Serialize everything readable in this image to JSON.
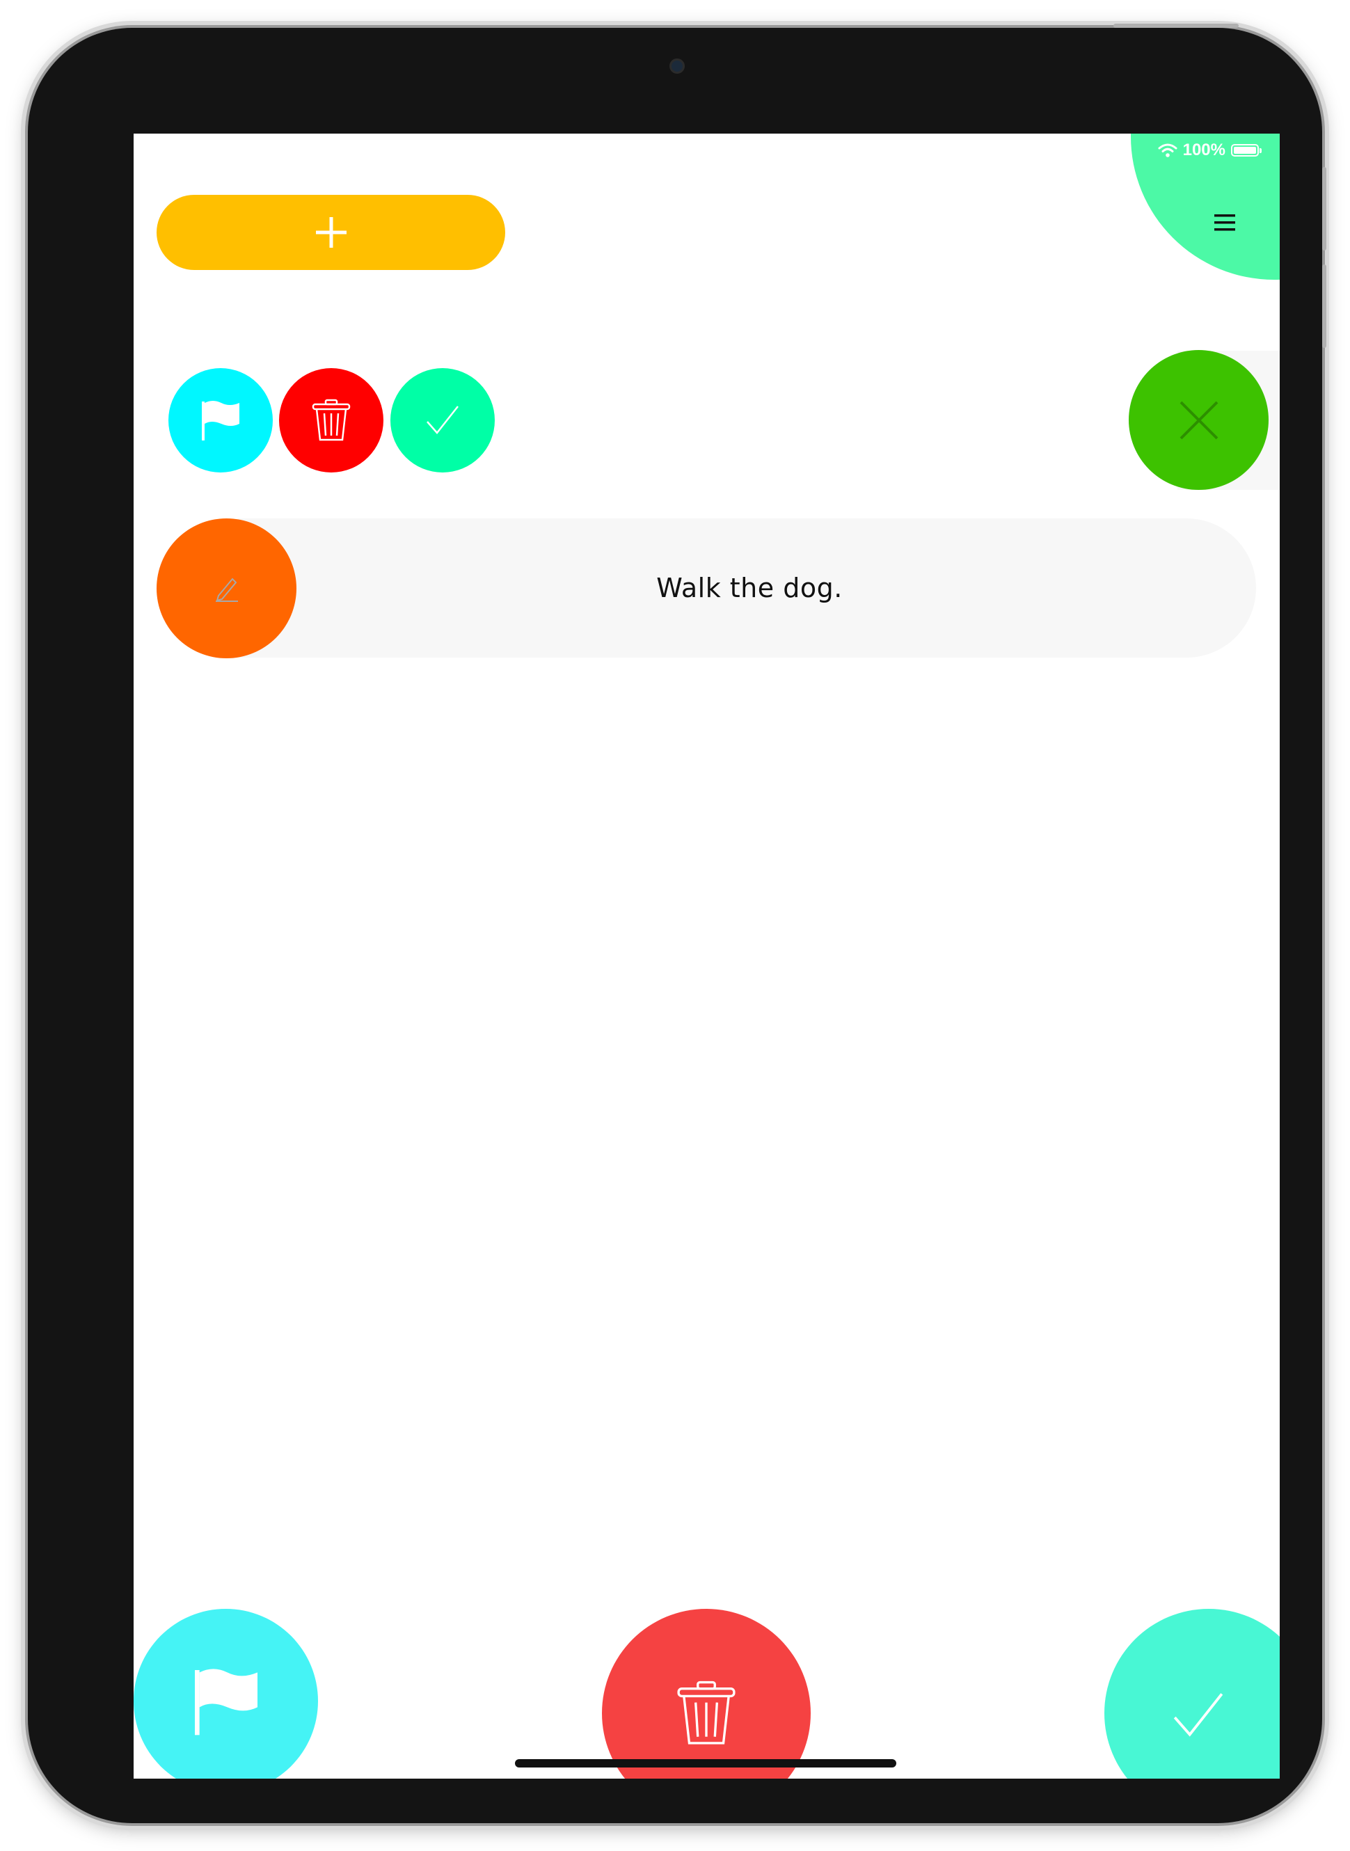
{
  "status_bar": {
    "battery_text": "100%",
    "battery_level": 1.0
  },
  "icons": {
    "menu": "hamburger-icon",
    "add": "plus-icon",
    "flag": "flag-icon",
    "trash": "trash-icon",
    "check": "checkmark-icon",
    "close": "close-icon",
    "edit": "pencil-icon",
    "wifi": "wifi-icon",
    "battery": "battery-icon"
  },
  "tasks": [
    {
      "text": "Walk the dog."
    }
  ],
  "colors": {
    "add_button": "#ffbf00",
    "corner_menu": "#4cf9a6",
    "flag_small": "#00f7ff",
    "trash_small": "#ff0000",
    "check_small": "#00ffa6",
    "close_button": "#3dc200",
    "edit_button": "#ff6600",
    "flag_large": "#45f3f5",
    "trash_large": "#f54242",
    "check_large": "#48f7d4"
  }
}
